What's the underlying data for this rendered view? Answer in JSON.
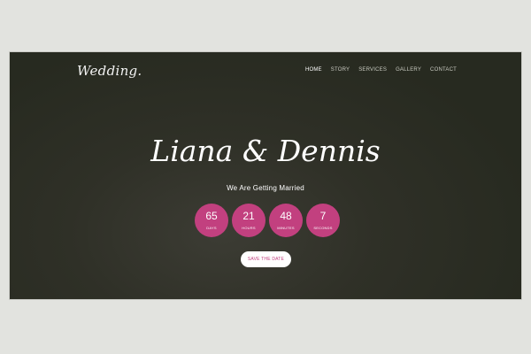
{
  "brand": {
    "logo_text": "Wedding."
  },
  "nav": {
    "items": [
      {
        "label": "HOME"
      },
      {
        "label": "STORY"
      },
      {
        "label": "SERVICES"
      },
      {
        "label": "GALLERY"
      },
      {
        "label": "CONTACT"
      }
    ]
  },
  "hero": {
    "title": "Liana & Dennis",
    "subtitle": "We Are Getting Married",
    "countdown": [
      {
        "value": "65",
        "unit": "DAYS"
      },
      {
        "value": "21",
        "unit": "HOURS"
      },
      {
        "value": "48",
        "unit": "MINUTES"
      },
      {
        "value": "7",
        "unit": "SECONDS"
      }
    ],
    "cta_label": "SAVE THE DATE"
  },
  "colors": {
    "accent": "#c2407f",
    "background": "#2f3027",
    "page": "#e2e3df"
  }
}
